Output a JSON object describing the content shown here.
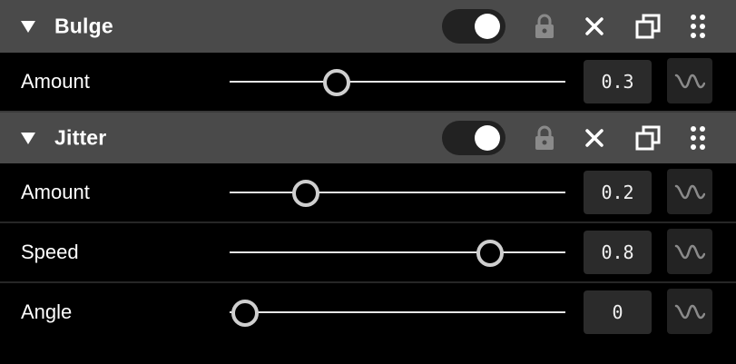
{
  "effects": [
    {
      "title": "Bulge",
      "enabled": true,
      "params": [
        {
          "label": "Amount",
          "value": "0.3",
          "slider_fraction": 0.3
        }
      ]
    },
    {
      "title": "Jitter",
      "enabled": true,
      "params": [
        {
          "label": "Amount",
          "value": "0.2",
          "slider_fraction": 0.2
        },
        {
          "label": "Speed",
          "value": "0.8",
          "slider_fraction": 0.8
        },
        {
          "label": "Angle",
          "value": "0",
          "slider_fraction": 0.0
        }
      ]
    }
  ],
  "icons": {
    "collapse": "triangle-down-icon",
    "lock": "lock-icon",
    "remove": "close-icon",
    "duplicate": "duplicate-icon",
    "drag": "grip-icon",
    "modulate": "wave-icon"
  },
  "colors": {
    "header_bg": "#4a4a4a",
    "row_bg": "#000000",
    "toggle_bg": "#222222",
    "value_bg": "#2b2b2b",
    "lock_icon": "#8a8a8a"
  }
}
